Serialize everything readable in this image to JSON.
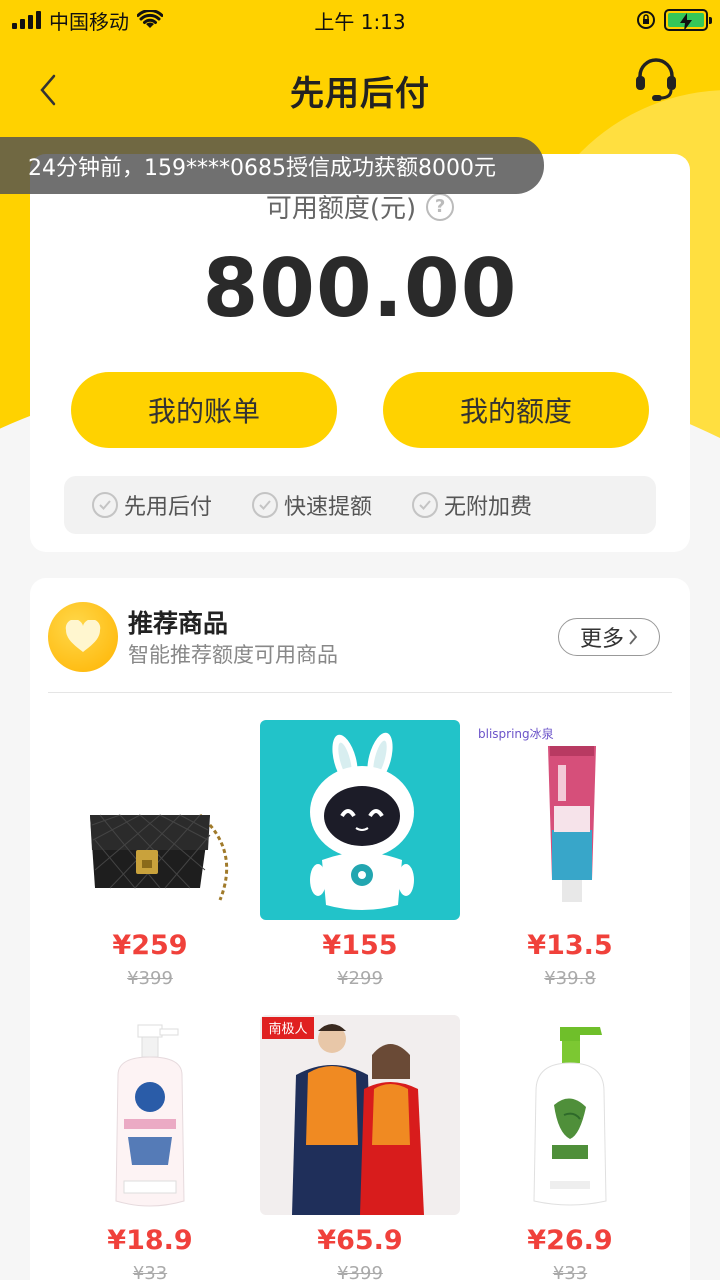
{
  "status_bar": {
    "carrier": "中国移动",
    "time": "上午 1:13"
  },
  "nav": {
    "title": "先用后付"
  },
  "toast": {
    "text": "24分钟前，159****0685授信成功获额8000元"
  },
  "credit": {
    "label": "可用额度(元)",
    "amount": "800.00",
    "buttons": {
      "bill": "我的账单",
      "quota": "我的额度"
    },
    "features": [
      "先用后付",
      "快速提额",
      "无附加费"
    ]
  },
  "recommend": {
    "title": "推荐商品",
    "subtitle": "智能推荐额度可用商品",
    "more": "更多",
    "products": [
      {
        "price": "¥259",
        "old_price": "¥399",
        "icon": "handbag-icon"
      },
      {
        "price": "¥155",
        "old_price": "¥299",
        "icon": "robot-toy-icon"
      },
      {
        "price": "¥13.5",
        "old_price": "¥39.8",
        "icon": "toothpaste-icon",
        "brand": "blispring冰泉"
      },
      {
        "price": "¥18.9",
        "old_price": "¥33",
        "icon": "detergent-bottle-icon"
      },
      {
        "price": "¥65.9",
        "old_price": "¥399",
        "icon": "thermal-wear-icon",
        "brand": "南极人"
      },
      {
        "price": "¥26.9",
        "old_price": "¥33",
        "icon": "shower-gel-icon"
      }
    ]
  },
  "colors": {
    "brand_yellow": "#ffd200",
    "price_red": "#f0413b"
  }
}
